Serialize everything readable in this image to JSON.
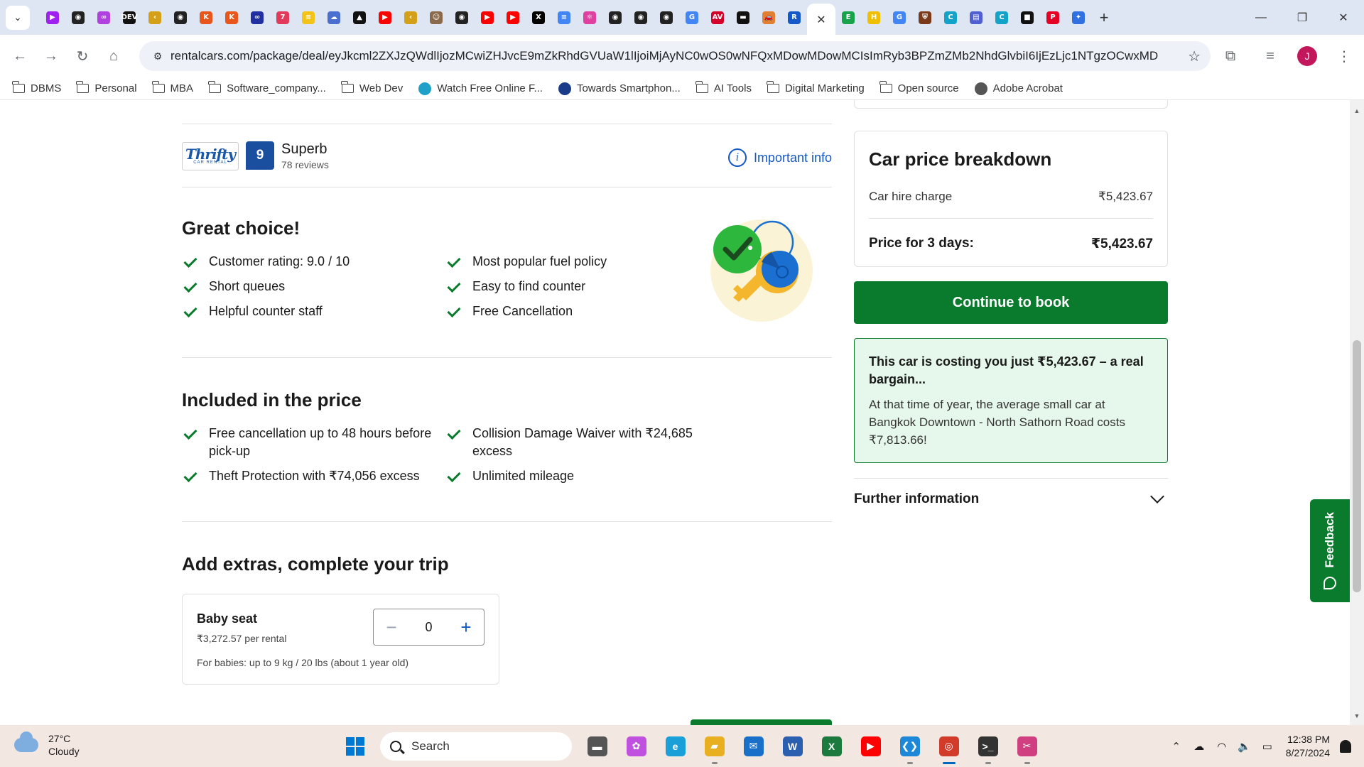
{
  "browser": {
    "tab_favicons": [
      {
        "name": "playlist-tab-icon",
        "glyph": "▶",
        "color": "#a020f0"
      },
      {
        "name": "github-tab-icon",
        "glyph": "◉",
        "color": "#222222"
      },
      {
        "name": "messenger-tab-icon",
        "glyph": "∞",
        "color": "#b040e0"
      },
      {
        "name": "dev-tab-icon",
        "glyph": "DEV",
        "color": "#111111"
      },
      {
        "name": "leetcode-tab-icon",
        "glyph": "‹",
        "color": "#d4a017"
      },
      {
        "name": "github-tab-icon",
        "glyph": "◉",
        "color": "#222222"
      },
      {
        "name": "kaggle-tab-icon",
        "glyph": "K",
        "color": "#e8561b"
      },
      {
        "name": "kaggle-tab-icon",
        "glyph": "K",
        "color": "#e8561b"
      },
      {
        "name": "infinity-tab-icon",
        "glyph": "∞",
        "color": "#2030a0"
      },
      {
        "name": "calendar-tab-icon",
        "glyph": "7",
        "color": "#e23a5a"
      },
      {
        "name": "notes-tab-icon",
        "glyph": "≡",
        "color": "#f3c318"
      },
      {
        "name": "cloud-tab-icon",
        "glyph": "☁",
        "color": "#4a6fd0"
      },
      {
        "name": "triangle-tab-icon",
        "glyph": "▲",
        "color": "#111111"
      },
      {
        "name": "youtube-tab-icon",
        "glyph": "▶",
        "color": "#ff0000"
      },
      {
        "name": "leetcode-tab-icon",
        "glyph": "‹",
        "color": "#d4a017"
      },
      {
        "name": "avatar-tab-icon",
        "glyph": "☺",
        "color": "#8a6a4a"
      },
      {
        "name": "github-tab-icon",
        "glyph": "◉",
        "color": "#222222"
      },
      {
        "name": "youtube-tab-icon",
        "glyph": "▶",
        "color": "#ff0000"
      },
      {
        "name": "youtube-tab-icon",
        "glyph": "▶",
        "color": "#ff0000"
      },
      {
        "name": "x-tab-icon",
        "glyph": "X",
        "color": "#000000"
      },
      {
        "name": "docs-tab-icon",
        "glyph": "≡",
        "color": "#4285f4"
      },
      {
        "name": "react-tab-icon",
        "glyph": "⚛",
        "color": "#e040a0"
      },
      {
        "name": "github-tab-icon",
        "glyph": "◉",
        "color": "#222222"
      },
      {
        "name": "github-tab-icon",
        "glyph": "◉",
        "color": "#222222"
      },
      {
        "name": "github-tab-icon",
        "glyph": "◉",
        "color": "#222222"
      },
      {
        "name": "google-tab-icon",
        "glyph": "G",
        "color": "#4285f4"
      },
      {
        "name": "avis-tab-icon",
        "glyph": "AV",
        "color": "#d4002a"
      },
      {
        "name": "tag-tab-icon",
        "glyph": "▬",
        "color": "#111111"
      },
      {
        "name": "car-tab-icon",
        "glyph": "🚗",
        "color": "#e08030"
      },
      {
        "name": "rentalcars-tab-icon",
        "glyph": "R",
        "color": "#1558c8"
      }
    ],
    "active_tab_close": "✕",
    "tab_favicons_after": [
      {
        "name": "evernote-tab-icon",
        "glyph": "E",
        "color": "#17a34a"
      },
      {
        "name": "h-tab-icon",
        "glyph": "H",
        "color": "#f0c000"
      },
      {
        "name": "google-tab-icon",
        "glyph": "G",
        "color": "#4285f4"
      },
      {
        "name": "shield-tab-icon",
        "glyph": "⛨",
        "color": "#7a3a1a"
      },
      {
        "name": "canva-tab-icon",
        "glyph": "C",
        "color": "#13a3c8"
      },
      {
        "name": "app-tab-icon",
        "glyph": "▤",
        "color": "#5060d0"
      },
      {
        "name": "canva-tab-icon",
        "glyph": "C",
        "color": "#13a3c8"
      },
      {
        "name": "notion-tab-icon",
        "glyph": "■",
        "color": "#111111"
      },
      {
        "name": "pinterest-tab-icon",
        "glyph": "P",
        "color": "#e60023"
      },
      {
        "name": "puzzle-tab-icon",
        "glyph": "✦",
        "color": "#3070e0"
      }
    ],
    "url": "rentalcars.com/package/deal/eyJkcml2ZXJzQWdlIjozMCwiZHJvcE9mZkRhdGVUaW1lIjoiMjAyNC0wOS0wNFQxMDowMDowMCIsImRyb3BPZmZMb2NhdGlvbiI6IjEzLjc1NTgzOCwxMD...",
    "bookmarks": [
      {
        "label": "DBMS",
        "type": "folder"
      },
      {
        "label": "Personal",
        "type": "folder"
      },
      {
        "label": "MBA",
        "type": "folder"
      },
      {
        "label": "Software_company...",
        "type": "folder"
      },
      {
        "label": "Web Dev",
        "type": "folder"
      },
      {
        "label": "Watch Free Online F...",
        "type": "site",
        "color": "#1fa0c8"
      },
      {
        "label": "Towards Smartphon...",
        "type": "site",
        "color": "#1a3a8a"
      },
      {
        "label": "AI Tools",
        "type": "folder"
      },
      {
        "label": "Digital Marketing",
        "type": "folder"
      },
      {
        "label": "Open source",
        "type": "folder"
      },
      {
        "label": "Adobe Acrobat",
        "type": "site",
        "color": "#555555"
      }
    ],
    "profile_initial": "J"
  },
  "supplier": {
    "logo_text": "Thrifty",
    "logo_sub": "CAR RENTAL",
    "score": "9",
    "rating_label": "Superb",
    "reviews": "78 reviews",
    "important_info": "Important info"
  },
  "great_choice": {
    "title": "Great choice!",
    "items": [
      "Customer rating: 9.0 / 10",
      "Most popular fuel policy",
      "Short queues",
      "Easy to find counter",
      "Helpful counter staff",
      "Free Cancellation"
    ]
  },
  "included": {
    "title": "Included in the price",
    "items": [
      "Free cancellation up to 48 hours before pick-up",
      "Collision Damage Waiver with ₹24,685 excess",
      "Theft Protection with ₹74,056 excess",
      "Unlimited mileage"
    ]
  },
  "extras": {
    "title": "Add extras, complete your trip",
    "item_name": "Baby seat",
    "item_price": "₹3,272.57 per rental",
    "item_note": "For babies: up to 9 kg / 20 lbs (about 1 year old)",
    "quantity": "0",
    "minus": "−",
    "plus": "+"
  },
  "price": {
    "title": "Car price breakdown",
    "hire_label": "Car hire charge",
    "hire_value": "₹5,423.67",
    "total_label": "Price for 3 days:",
    "total_value": "₹5,423.67",
    "continue_label": "Continue to book"
  },
  "bargain": {
    "headline": "This car is costing you just ₹5,423.67 – a real bargain...",
    "text": "At that time of year, the average small car at Bangkok Downtown - North Sathorn Road costs ₹7,813.66!"
  },
  "further_info": "Further information",
  "feedback_label": "Feedback",
  "taskbar": {
    "temp": "27°C",
    "condition": "Cloudy",
    "search_placeholder": "Search",
    "time": "12:38 PM",
    "date": "8/27/2024",
    "apps": [
      {
        "name": "file-explorer-app",
        "glyph": "▬",
        "color": "#555555"
      },
      {
        "name": "copilot-app",
        "glyph": "✿",
        "color": "#c050e0"
      },
      {
        "name": "edge-app",
        "glyph": "e",
        "color": "#1a9fd8"
      },
      {
        "name": "folder-app",
        "glyph": "▰",
        "color": "#e8b020"
      },
      {
        "name": "mail-app",
        "glyph": "✉",
        "color": "#1a6fc8"
      },
      {
        "name": "word-app",
        "glyph": "W",
        "color": "#2b5faf"
      },
      {
        "name": "excel-app",
        "glyph": "X",
        "color": "#1d7a3e"
      },
      {
        "name": "youtube-app",
        "glyph": "▶",
        "color": "#ff0000"
      },
      {
        "name": "vscode-app",
        "glyph": "❮❯",
        "color": "#1e88d8"
      },
      {
        "name": "chrome-app",
        "glyph": "◎",
        "color": "#d23a2a"
      },
      {
        "name": "terminal-app",
        "glyph": ">_",
        "color": "#333333"
      },
      {
        "name": "snipping-app",
        "glyph": "✂",
        "color": "#d04080"
      }
    ]
  },
  "colors": {
    "brand_green": "#0a7a2c",
    "link_blue": "#1558c8",
    "score_blue": "#1a4fa0",
    "bargain_bg": "#e6f8ec"
  }
}
